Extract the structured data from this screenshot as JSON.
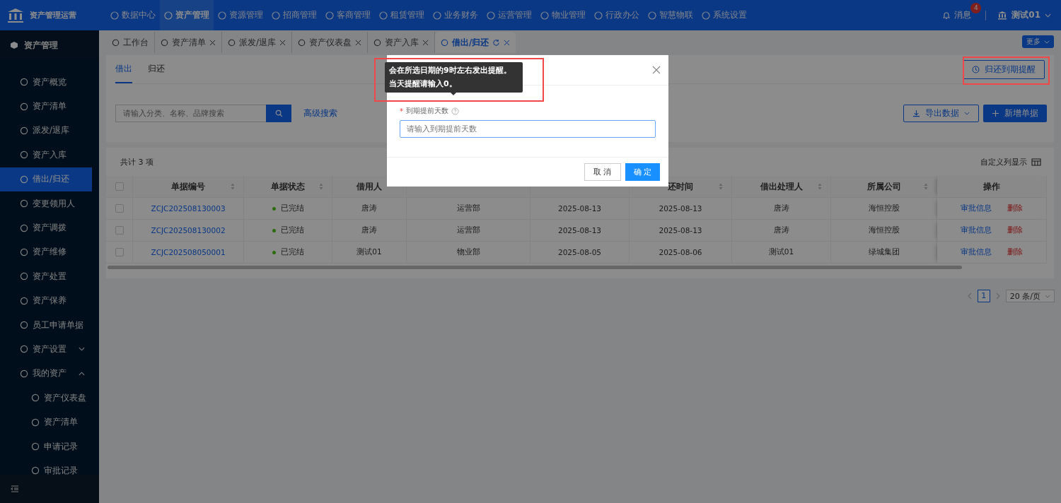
{
  "app": {
    "title": "资产管理运营"
  },
  "nav": {
    "items": [
      {
        "label": "数据中心",
        "selected": false
      },
      {
        "label": "资产管理",
        "selected": true
      },
      {
        "label": "资源管理",
        "selected": false
      },
      {
        "label": "招商管理",
        "selected": false
      },
      {
        "label": "客商管理",
        "selected": false
      },
      {
        "label": "租赁管理",
        "selected": false
      },
      {
        "label": "业务财务",
        "selected": false
      },
      {
        "label": "运营管理",
        "selected": false
      },
      {
        "label": "物业管理",
        "selected": false
      },
      {
        "label": "行政办公",
        "selected": false
      },
      {
        "label": "智慧物联",
        "selected": false
      },
      {
        "label": "系统设置",
        "selected": false
      }
    ],
    "messages": {
      "label": "消息",
      "badge": "4"
    },
    "user": "测试01"
  },
  "sidebar": {
    "title": "资产管理",
    "items": [
      {
        "label": "资产概览",
        "selected": false
      },
      {
        "label": "资产清单",
        "selected": false
      },
      {
        "label": "派发/退库",
        "selected": false
      },
      {
        "label": "资产入库",
        "selected": false
      },
      {
        "label": "借出/归还",
        "selected": true
      },
      {
        "label": "变更领用人",
        "selected": false
      },
      {
        "label": "资产调拨",
        "selected": false
      },
      {
        "label": "资产维修",
        "selected": false
      },
      {
        "label": "资产处置",
        "selected": false
      },
      {
        "label": "资产保养",
        "selected": false
      },
      {
        "label": "员工申请单据",
        "selected": false
      },
      {
        "label": "资产设置",
        "selected": false,
        "expanded": false
      },
      {
        "label": "我的资产",
        "selected": false,
        "expanded": true,
        "children": [
          {
            "label": "资产仪表盘",
            "selected": false
          },
          {
            "label": "资产清单",
            "selected": false
          },
          {
            "label": "申请记录",
            "selected": false
          },
          {
            "label": "审批记录",
            "selected": false
          }
        ]
      }
    ]
  },
  "page_tabs": {
    "items": [
      {
        "label": "工作台",
        "selected": false,
        "closable": false
      },
      {
        "label": "资产清单",
        "selected": false,
        "closable": true
      },
      {
        "label": "派发/退库",
        "selected": false,
        "closable": true
      },
      {
        "label": "资产仪表盘",
        "selected": false,
        "closable": true
      },
      {
        "label": "资产入库",
        "selected": false,
        "closable": true
      },
      {
        "label": "借出/归还",
        "selected": true,
        "closable": true
      }
    ],
    "more": "更多"
  },
  "card": {
    "tabs": [
      {
        "label": "借出",
        "selected": true
      },
      {
        "label": "归还",
        "selected": false
      }
    ],
    "reminder_button": "归还到期提醒",
    "search": {
      "placeholder": "请输入分类、名称、品牌搜索"
    },
    "advanced_search": "高级搜索",
    "export_button": "导出数据",
    "add_button": "新增单据",
    "total": "共计 3 项",
    "column_settings": "自定义列显示"
  },
  "table": {
    "all_checked": false,
    "columns": [
      {
        "label": "单据编号",
        "sortable": true
      },
      {
        "label": "单据状态",
        "sortable": true
      },
      {
        "label": "借用人"
      },
      {},
      {},
      {
        "label": "还时间",
        "sortable": true
      },
      {
        "label": "借出处理人",
        "sortable": true
      },
      {
        "label": "所属公司",
        "sortable": true
      },
      {
        "label": "操作"
      }
    ],
    "rows": [
      {
        "checked": false,
        "id": "ZCJC202508130003",
        "status": "已完结",
        "color": "#2d6c0e",
        "borrower": "唐涛",
        "department": "运营部",
        "borrow_date": "2025-08-13",
        "return_date": "2025-08-13",
        "handler": "唐涛",
        "company": "海恒控股",
        "actions": [
          "审批信息",
          "删除"
        ]
      },
      {
        "checked": false,
        "id": "ZCJC202508130002",
        "status": "已完结",
        "color": "#2d6c0e",
        "borrower": "唐涛",
        "department": "运营部",
        "borrow_date": "2025-08-13",
        "return_date": "2025-08-13",
        "handler": "唐涛",
        "company": "海恒控股",
        "actions": [
          "审批信息",
          "删除"
        ]
      },
      {
        "checked": false,
        "id": "ZCJC202508050001",
        "status": "已完结",
        "color": "#2d6c0e",
        "borrower": "测试01",
        "department": "物业部",
        "borrow_date": "2025-08-05",
        "return_date": "2025-08-06",
        "handler": "测试01",
        "company": "绿城集团",
        "actions": [
          "审批信息",
          "删除"
        ]
      }
    ]
  },
  "pagination": {
    "pages": [
      {
        "label": "1",
        "selected": true
      }
    ],
    "page_size": "20 条/页"
  },
  "dialog": {
    "field": {
      "required_mark": "*",
      "label": "到期提前天数",
      "placeholder": "请输入到期提前天数"
    },
    "tooltip": "会在所选日期的9时左右发出提醒。当天提醒请输入0。",
    "buttons": [
      {
        "label": "取 消",
        "kind": "default"
      },
      {
        "label": "确 定",
        "kind": "primary"
      }
    ]
  }
}
